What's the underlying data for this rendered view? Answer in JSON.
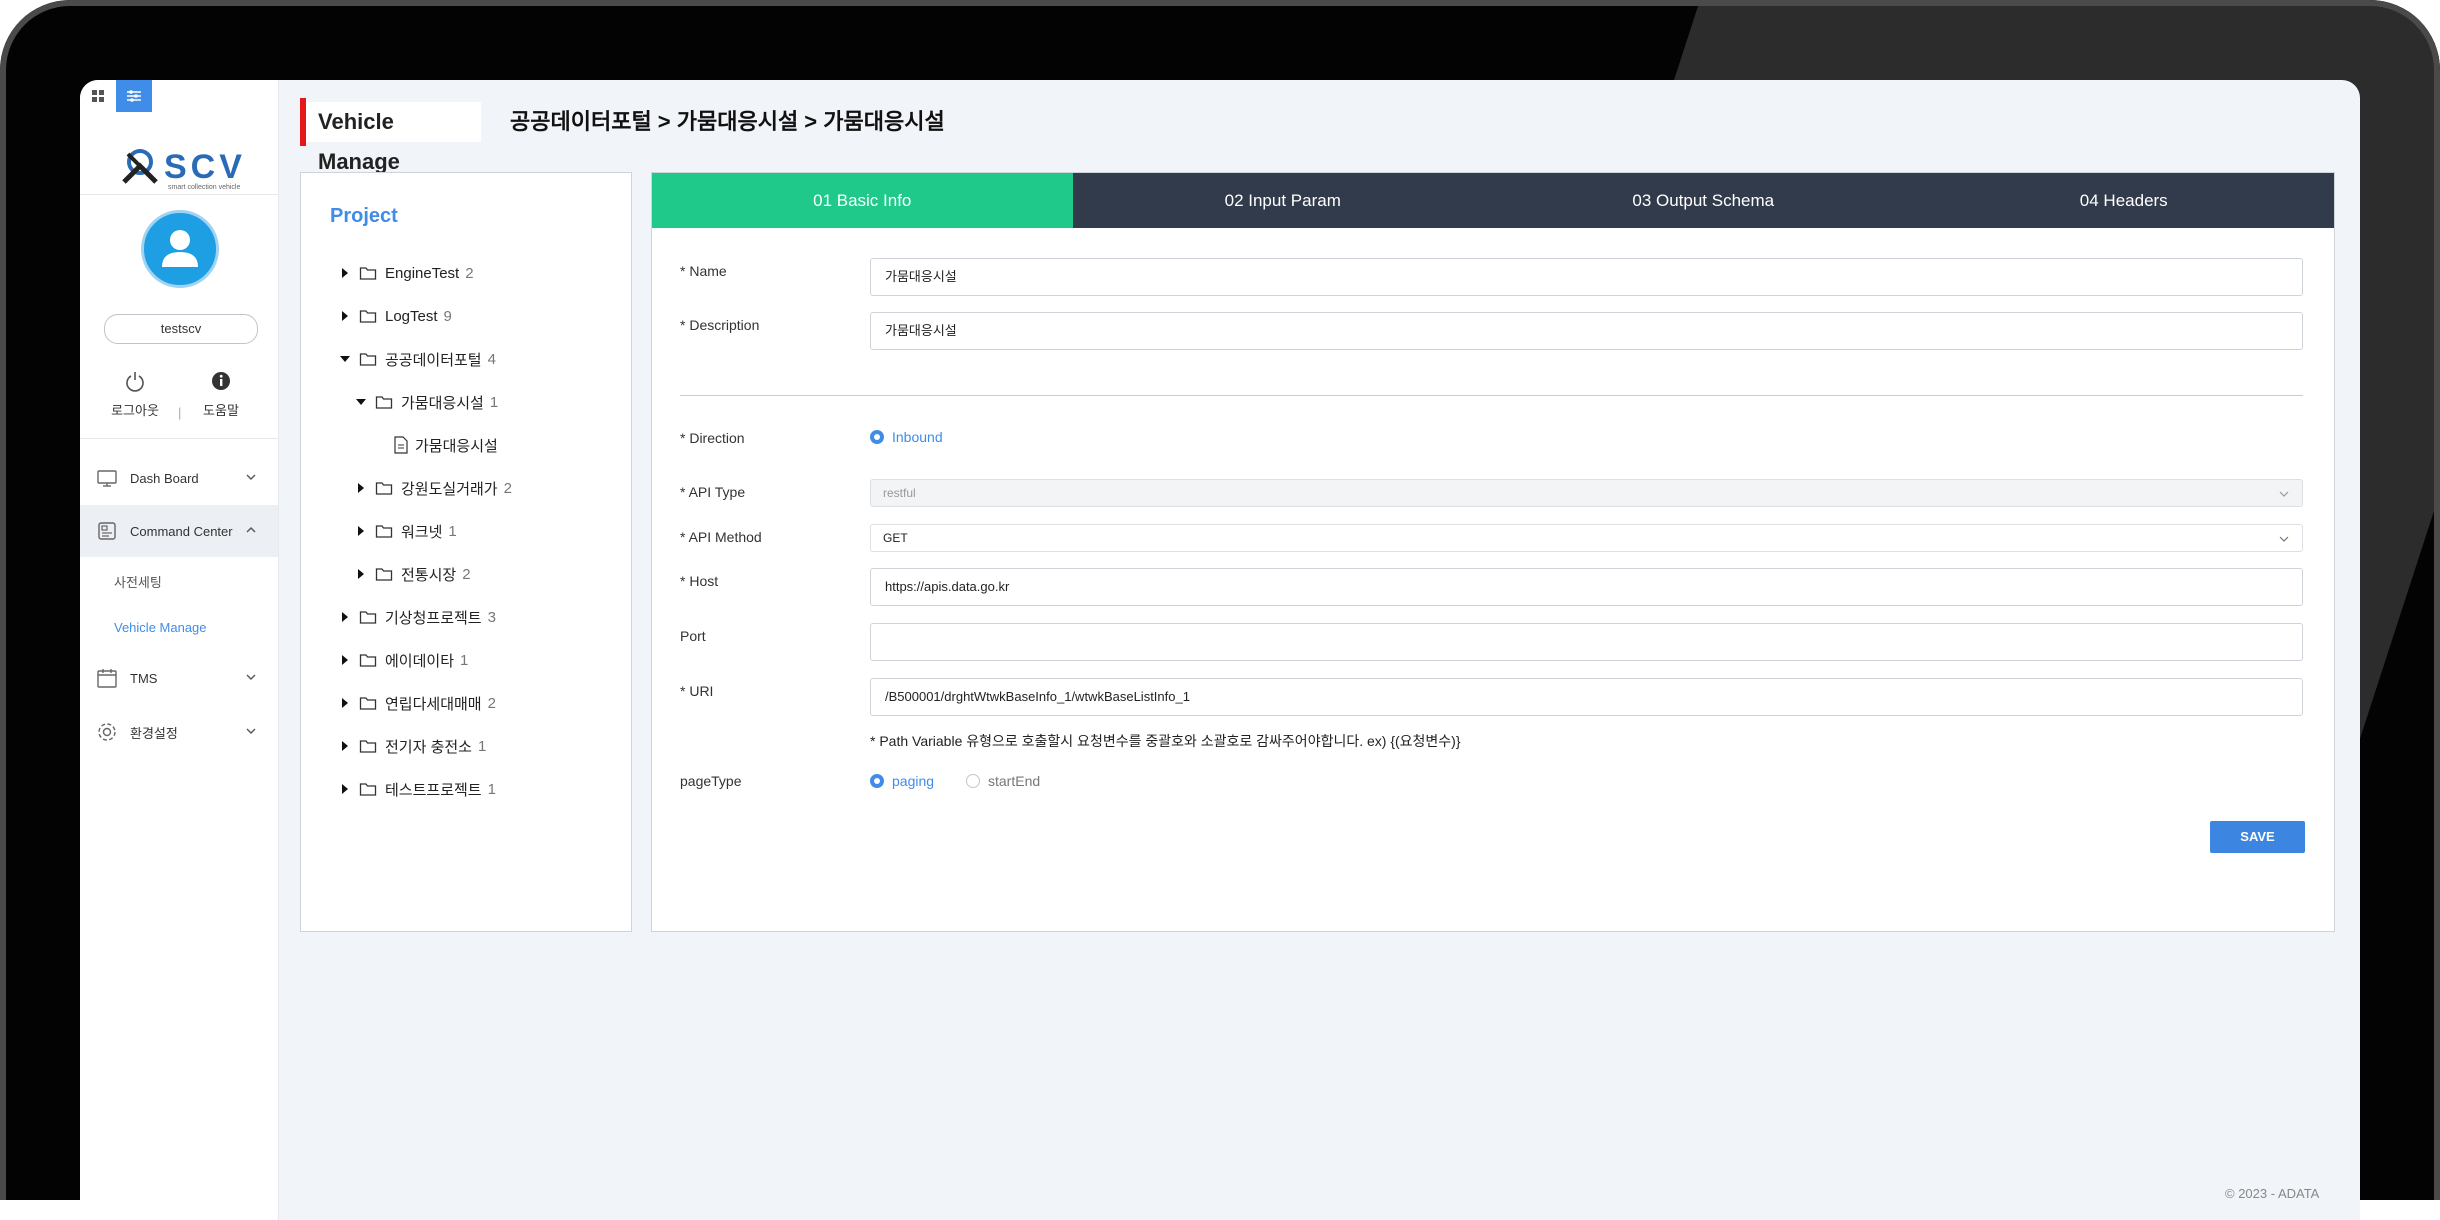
{
  "colors": {
    "accent": "#3f8de8",
    "tab_active": "#1ec98a",
    "tab_inactive": "#323b4b",
    "header_accent": "#e41818"
  },
  "sidebar": {
    "top_icons": [
      "grid-icon",
      "sliders-icon"
    ],
    "logo_text": "SCV",
    "logo_sub": "smart collection vehicle",
    "username": "testscv",
    "logout_label": "로그아웃",
    "help_label": "도움말",
    "nav": {
      "dashboard": "Dash Board",
      "command_center": "Command Center",
      "sub_presetting": "사전세팅",
      "sub_vehicle": "Vehicle Manage",
      "tms": "TMS",
      "settings": "환경설정"
    }
  },
  "header": {
    "title": "Vehicle Manage",
    "breadcrumb": "공공데이터포털 > 가뭄대응시설 > 가뭄대응시설"
  },
  "project": {
    "title": "Project",
    "tree": [
      {
        "label": "EngineTest",
        "count": "2"
      },
      {
        "label": "LogTest",
        "count": "9"
      },
      {
        "label": "공공데이터포털",
        "count": "4"
      },
      {
        "label": "가뭄대응시설",
        "count": "1"
      },
      {
        "label": "가뭄대응시설",
        "count": ""
      },
      {
        "label": "강원도실거래가",
        "count": "2"
      },
      {
        "label": "워크넷",
        "count": "1"
      },
      {
        "label": "전통시장",
        "count": "2"
      },
      {
        "label": "기상청프로젝트",
        "count": "3"
      },
      {
        "label": "에이데이타",
        "count": "1"
      },
      {
        "label": "연립다세대매매",
        "count": "2"
      },
      {
        "label": "전기자 충전소",
        "count": "1"
      },
      {
        "label": "테스트프로젝트",
        "count": "1"
      }
    ]
  },
  "tabs": [
    "01 Basic Info",
    "02 Input Param",
    "03 Output Schema",
    "04 Headers"
  ],
  "form": {
    "name_label": "* Name",
    "name_value": "가뭄대응시설",
    "desc_label": "* Description",
    "desc_value": "가뭄대응시설",
    "direction_label": "* Direction",
    "direction_value": "Inbound",
    "api_type_label": "* API Type",
    "api_type_value": "restful",
    "api_method_label": "* API Method",
    "api_method_value": "GET",
    "host_label": "* Host",
    "host_value": "https://apis.data.go.kr",
    "port_label": "Port",
    "port_value": "",
    "uri_label": "* URI",
    "uri_value": "/B500001/drghtWtwkBaseInfo_1/wtwkBaseListInfo_1",
    "hint": "* Path Variable 유형으로 호출할시 요청변수를 중괄호와 소괄호로 감싸주어야합니다. ex) {(요청변수)}",
    "pagetype_label": "pageType",
    "pagetype_options": [
      "paging",
      "startEnd"
    ],
    "save_label": "SAVE"
  },
  "footer": "© 2023 - ADATA"
}
